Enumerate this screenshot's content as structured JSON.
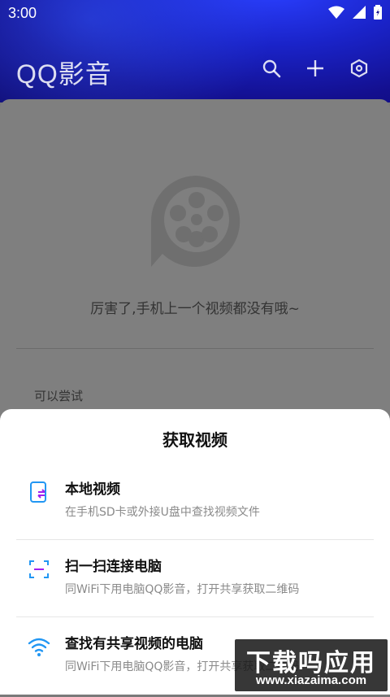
{
  "status_bar": {
    "time": "3:00"
  },
  "app": {
    "title": "QQ影音"
  },
  "header_actions": [
    {
      "icon": "search-icon"
    },
    {
      "icon": "plus-icon"
    },
    {
      "icon": "settings-hexagon-icon"
    }
  ],
  "main": {
    "empty_message": "厉害了,手机上一个视频都没有哦~",
    "try_label": "可以尝试"
  },
  "sheet": {
    "title": "获取视频",
    "options": [
      {
        "title": "本地视频",
        "desc": "在手机SD卡或外接U盘中查找视频文件",
        "icon": "local-video-icon",
        "color": "#2196f3"
      },
      {
        "title": "扫一扫连接电脑",
        "desc": "同WiFi下用电脑QQ影音，打开共享获取二维码",
        "icon": "scan-icon",
        "color": "#2196f3"
      },
      {
        "title": "查找有共享视频的电脑",
        "desc": "同WiFi下用电脑QQ影音，打开共享获取二维码",
        "icon": "wifi-icon",
        "color": "#2196f3"
      }
    ]
  },
  "watermark": {
    "main": "下载吗应用",
    "sub": "www.xiazaima.com"
  },
  "colors": {
    "accent": "#2196f3",
    "accent_secondary": "#a020f0",
    "header_dark": "#130f8e"
  }
}
